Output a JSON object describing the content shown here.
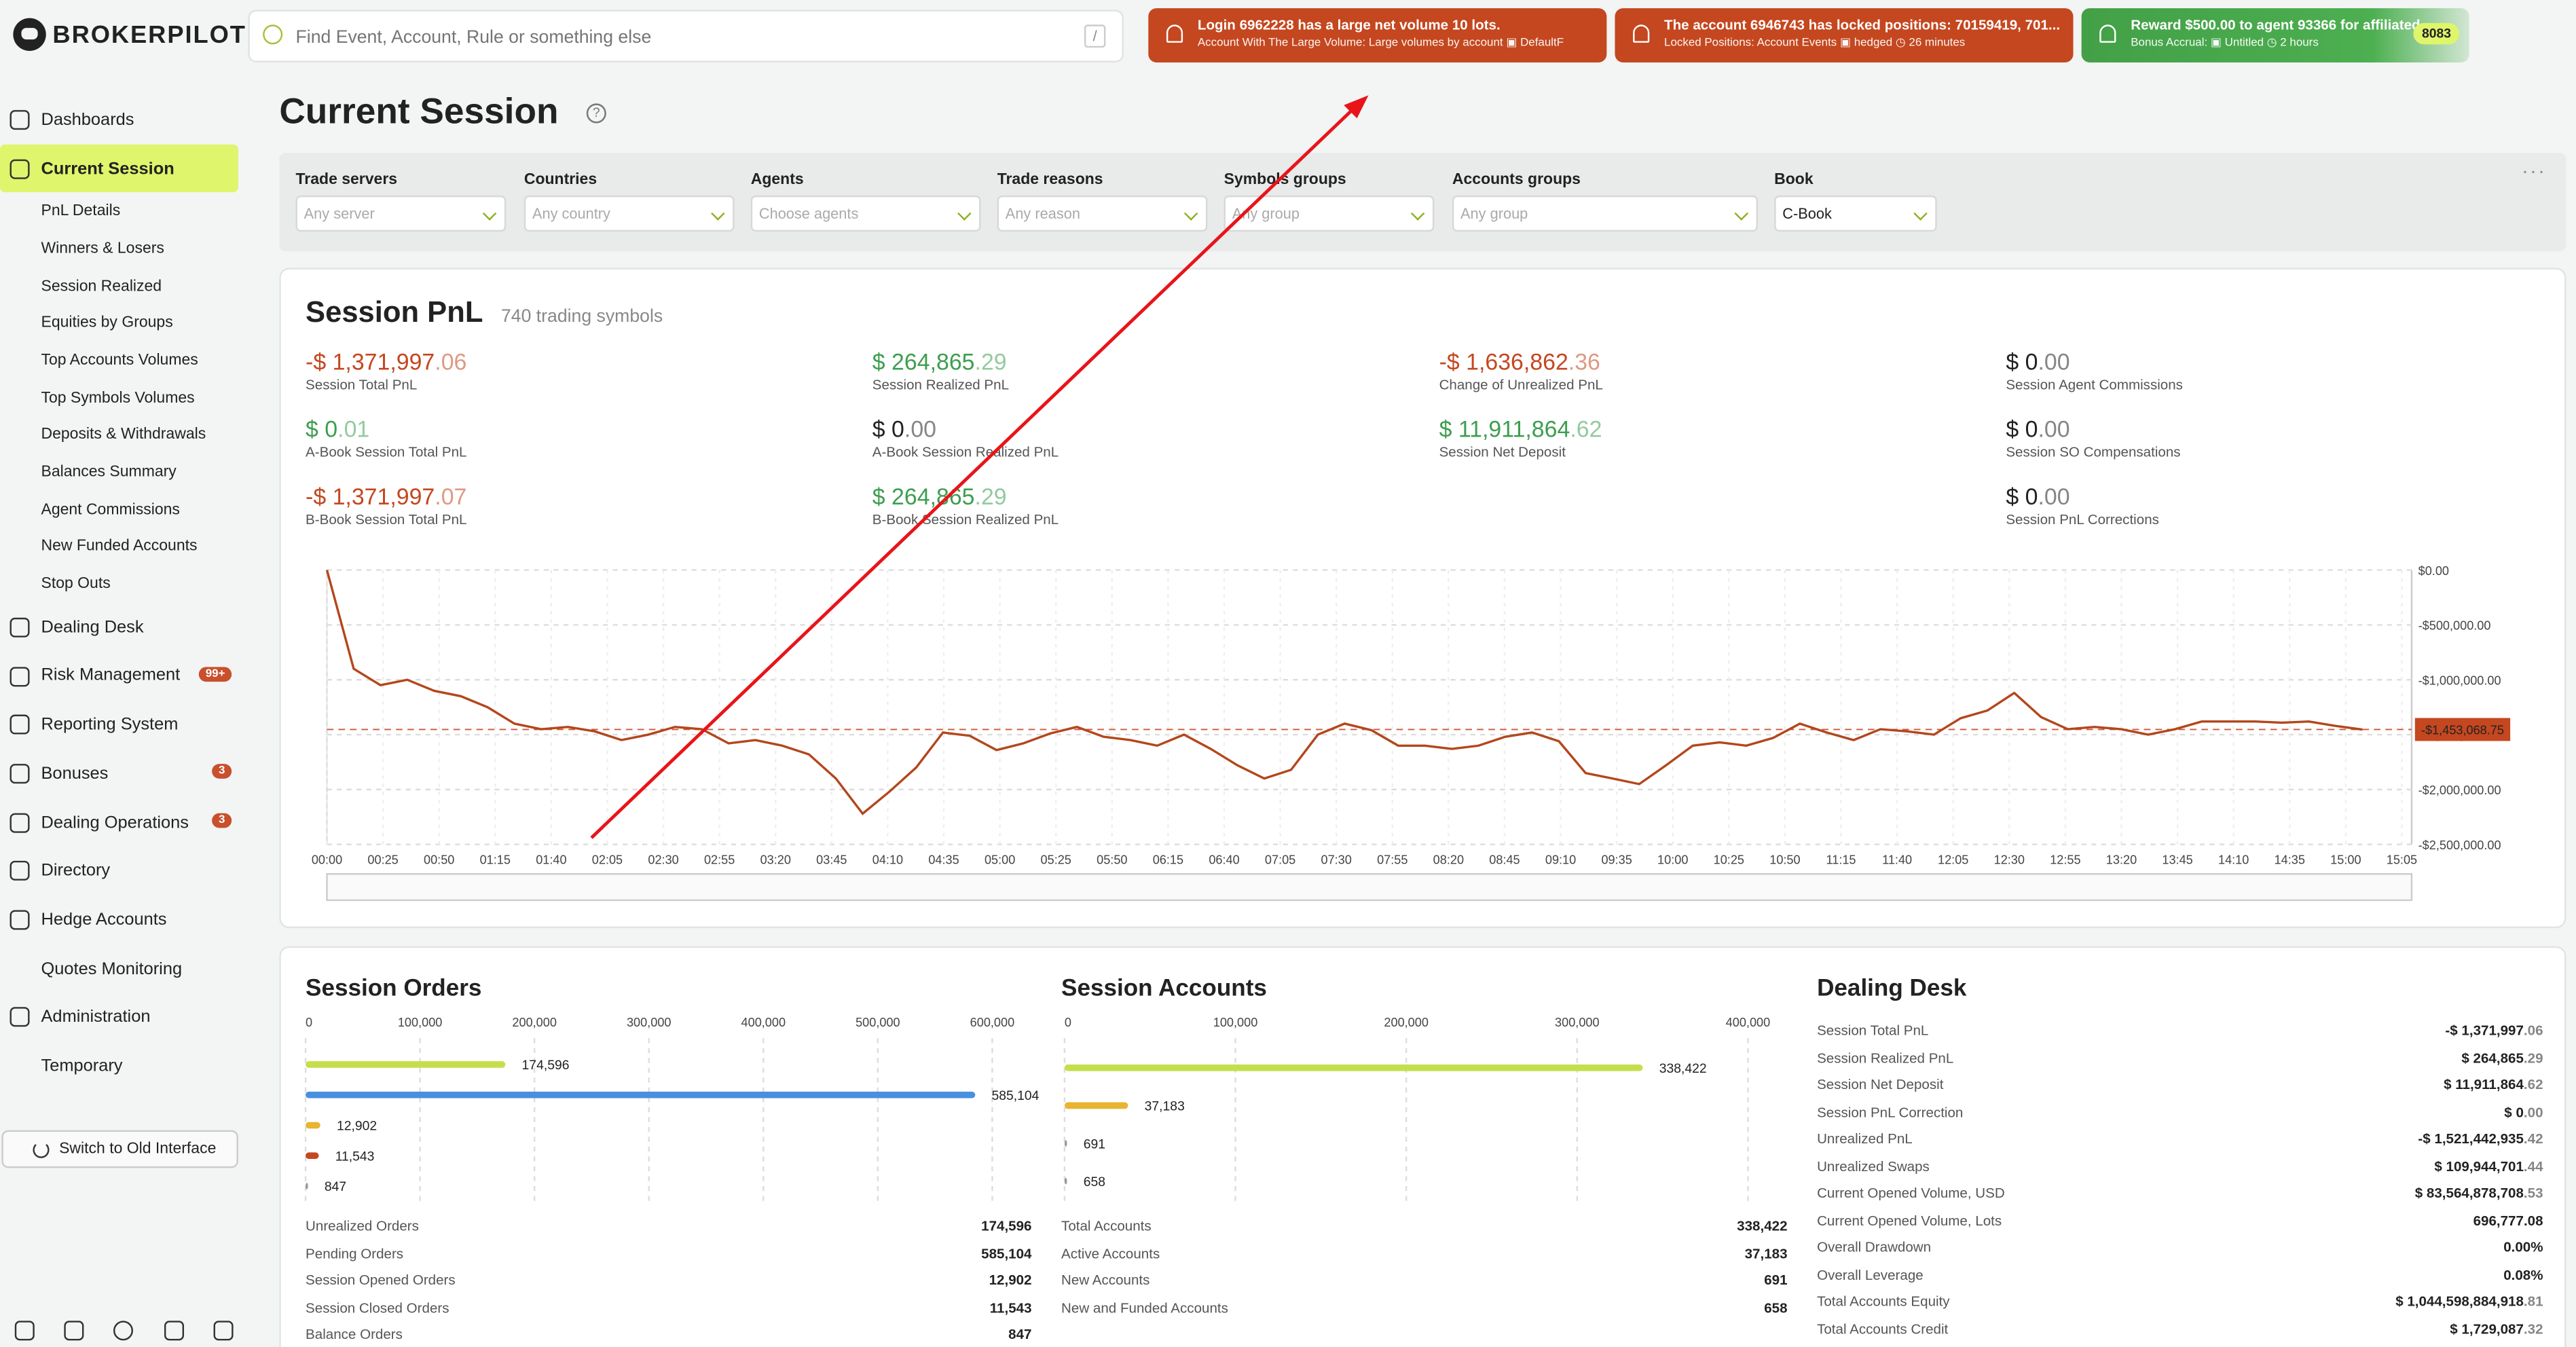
{
  "app": {
    "logo_text": "BROKERPILOT"
  },
  "search": {
    "placeholder": "Find Event, Account, Rule or something else",
    "shortcut": "/"
  },
  "notifications": [
    {
      "title": "Login 6962228 has a large net volume 10 lots.",
      "detail": "Account With The Large Volume: Large volumes by account",
      "tag": "DefaultF",
      "color": "#c4471f"
    },
    {
      "title": "The account 6946743 has locked positions: 70159419, 701...",
      "detail": "Locked Positions: Account Events",
      "tag": "hedged",
      "time": "26 minutes",
      "color": "#c4471f"
    },
    {
      "title": "Reward $500.00 to agent 93366 for affiliated",
      "detail": "Bonus Accrual:",
      "tag": "Untitled",
      "time": "2 hours",
      "count": "8083",
      "color": "#43a047"
    }
  ],
  "sidebar": {
    "items": [
      {
        "label": "Dashboards",
        "icon": "dashboard-icon"
      },
      {
        "label": "Current Session",
        "icon": "session-icon",
        "active": true
      },
      {
        "label": "Dealing Desk",
        "icon": "dealing-desk-icon"
      },
      {
        "label": "Risk Management",
        "icon": "risk-icon",
        "badge": "99+"
      },
      {
        "label": "Reporting System",
        "icon": "report-icon"
      },
      {
        "label": "Bonuses",
        "icon": "bonus-icon",
        "badge": "3"
      },
      {
        "label": "Dealing Operations",
        "icon": "operations-icon",
        "badge": "3"
      },
      {
        "label": "Directory",
        "icon": "directory-icon"
      },
      {
        "label": "Hedge Accounts",
        "icon": "hedge-icon"
      },
      {
        "label": "Quotes Monitoring"
      },
      {
        "label": "Administration",
        "icon": "admin-icon"
      },
      {
        "label": "Temporary"
      }
    ],
    "sub_items": [
      "PnL Details",
      "Winners & Losers",
      "Session Realized",
      "Equities by Groups",
      "Top Accounts Volumes",
      "Top Symbols Volumes",
      "Deposits & Withdrawals",
      "Balances Summary",
      "Agent Commissions",
      "New Funded Accounts",
      "Stop Outs"
    ],
    "switch_label": "Switch to Old Interface"
  },
  "page": {
    "title": "Current Session",
    "help": "?"
  },
  "filters": [
    {
      "label": "Trade servers",
      "placeholder": "Any server"
    },
    {
      "label": "Countries",
      "placeholder": "Any country"
    },
    {
      "label": "Agents",
      "placeholder": "Choose agents"
    },
    {
      "label": "Trade reasons",
      "placeholder": "Any reason"
    },
    {
      "label": "Symbols groups",
      "placeholder": "Any group"
    },
    {
      "label": "Accounts groups",
      "placeholder": "Any group"
    },
    {
      "label": "Book",
      "value": "C-Book"
    }
  ],
  "filters_more": "···",
  "session_pnl": {
    "title": "Session PnL",
    "subtitle": "740 trading symbols",
    "metrics": [
      {
        "main": "-$ 1,371,997",
        "cents": ".06",
        "label": "Session Total PnL",
        "tone": "neg"
      },
      {
        "main": "$ 0",
        "cents": ".01",
        "label": "A-Book Session Total PnL",
        "tone": "pos"
      },
      {
        "main": "-$ 1,371,997",
        "cents": ".07",
        "label": "B-Book Session Total PnL",
        "tone": "neg"
      },
      {
        "main": "$ 264,865",
        "cents": ".29",
        "label": "Session Realized PnL",
        "tone": "pos"
      },
      {
        "main": "$ 0",
        "cents": ".00",
        "label": "A-Book Session Realized PnL",
        "tone": "zero"
      },
      {
        "main": "$ 264,865",
        "cents": ".29",
        "label": "B-Book Session Realized PnL",
        "tone": "pos"
      },
      {
        "main": "-$ 1,636,862",
        "cents": ".36",
        "label": "Change of Unrealized PnL",
        "tone": "neg"
      },
      {
        "main": "$ 11,911,864",
        "cents": ".62",
        "label": "Session Net Deposit",
        "tone": "pos"
      },
      {
        "main": "$ 0",
        "cents": ".00",
        "label": "Session Agent Commissions",
        "tone": "zero"
      },
      {
        "main": "$ 0",
        "cents": ".00",
        "label": "Session SO Compensations",
        "tone": "zero"
      },
      {
        "main": "$ 0",
        "cents": ".00",
        "label": "Session PnL Corrections",
        "tone": "zero"
      }
    ]
  },
  "chart_data": {
    "type": "line",
    "x_ticks": [
      "00:00",
      "00:25",
      "00:50",
      "01:15",
      "01:40",
      "02:05",
      "02:30",
      "02:55",
      "03:20",
      "03:45",
      "04:10",
      "04:35",
      "05:00",
      "05:25",
      "05:50",
      "06:15",
      "06:40",
      "07:05",
      "07:30",
      "07:55",
      "08:20",
      "08:45",
      "09:10",
      "09:35",
      "10:00",
      "10:25",
      "10:50",
      "11:15",
      "11:40",
      "12:05",
      "12:30",
      "12:55",
      "13:20",
      "13:45",
      "14:10",
      "14:35",
      "15:00",
      "15:05"
    ],
    "y_ticks": [
      "$0.00",
      "-$500,000.00",
      "-$1,000,000.00",
      "-$1,500,000.00",
      "-$2,000,000.00",
      "-$2,500,000.00"
    ],
    "ylim": [
      -2500000,
      0
    ],
    "current_value_label": "-$1,453,068.75",
    "current_value": -1453068.75,
    "line_color": "#b3471c",
    "y_values": [
      0,
      -900000,
      -1050000,
      -1000000,
      -1100000,
      -1150000,
      -1250000,
      -1400000,
      -1450000,
      -1430000,
      -1470000,
      -1550000,
      -1500000,
      -1430000,
      -1450000,
      -1580000,
      -1550000,
      -1600000,
      -1680000,
      -1900000,
      -2220000,
      -2020000,
      -1800000,
      -1480000,
      -1510000,
      -1640000,
      -1580000,
      -1490000,
      -1430000,
      -1520000,
      -1550000,
      -1600000,
      -1500000,
      -1630000,
      -1780000,
      -1900000,
      -1820000,
      -1500000,
      -1400000,
      -1460000,
      -1600000,
      -1600000,
      -1630000,
      -1600000,
      -1520000,
      -1480000,
      -1560000,
      -1850000,
      -1900000,
      -1950000,
      -1780000,
      -1600000,
      -1570000,
      -1600000,
      -1530000,
      -1400000,
      -1480000,
      -1550000,
      -1450000,
      -1470000,
      -1500000,
      -1350000,
      -1280000,
      -1120000,
      -1340000,
      -1450000,
      -1430000,
      -1450000,
      -1500000,
      -1450000,
      -1380000,
      -1380000,
      -1380000,
      -1390000,
      -1380000,
      -1420000,
      -1453068
    ]
  },
  "session_orders": {
    "title": "Session Orders",
    "axis": [
      "0",
      "100,000",
      "200,000",
      "300,000",
      "400,000",
      "500,000",
      "600,000"
    ],
    "max": 600000,
    "bars": [
      {
        "value": 174596,
        "label": "174,596",
        "color": "#c5df4c"
      },
      {
        "value": 585104,
        "label": "585,104",
        "color": "#4a8fde"
      },
      {
        "value": 12902,
        "label": "12,902",
        "color": "#e8b431"
      },
      {
        "value": 11543,
        "label": "11,543",
        "color": "#c4471f"
      },
      {
        "value": 847,
        "label": "847",
        "color": "#999999"
      }
    ],
    "rows": [
      {
        "k": "Unrealized Orders",
        "v": "174,596"
      },
      {
        "k": "Pending Orders",
        "v": "585,104"
      },
      {
        "k": "Session Opened Orders",
        "v": "12,902"
      },
      {
        "k": "Session Closed Orders",
        "v": "11,543"
      },
      {
        "k": "Balance Orders",
        "v": "847"
      }
    ]
  },
  "session_accounts": {
    "title": "Session Accounts",
    "axis": [
      "0",
      "100,000",
      "200,000",
      "300,000",
      "400,000"
    ],
    "max": 400000,
    "bars": [
      {
        "value": 338422,
        "label": "338,422",
        "color": "#c5df4c"
      },
      {
        "value": 37183,
        "label": "37,183",
        "color": "#e8b431"
      },
      {
        "value": 691,
        "label": "691",
        "color": "#999999"
      },
      {
        "value": 658,
        "label": "658",
        "color": "#999999"
      }
    ],
    "rows": [
      {
        "k": "Total Accounts",
        "v": "338,422"
      },
      {
        "k": "Active Accounts",
        "v": "37,183"
      },
      {
        "k": "New Accounts",
        "v": "691"
      },
      {
        "k": "New and Funded Accounts",
        "v": "658"
      }
    ]
  },
  "dealing_desk": {
    "title": "Dealing Desk",
    "rows": [
      {
        "k": "Session Total PnL",
        "main": "-$ 1,371,997",
        "cents": ".06",
        "tone": "neg"
      },
      {
        "k": "Session Realized PnL",
        "main": "$ 264,865",
        "cents": ".29",
        "tone": "pos"
      },
      {
        "k": "Session Net Deposit",
        "main": "$ 11,911,864",
        "cents": ".62",
        "tone": "pos"
      },
      {
        "k": "Session PnL Correction",
        "main": "$ 0",
        "cents": ".00",
        "tone": "pos"
      },
      {
        "k": "Unrealized PnL",
        "main": "-$ 1,521,442,935",
        "cents": ".42",
        "tone": "neg"
      },
      {
        "k": "Unrealized Swaps",
        "main": "$ 109,944,701",
        "cents": ".44",
        "tone": "pos"
      },
      {
        "k": "Current Opened Volume, USD",
        "main": "$ 83,564,878,708",
        "cents": ".53",
        "tone": "pos"
      },
      {
        "k": "Current Opened Volume, Lots",
        "main": "696,777.08",
        "cents": "",
        "tone": "zero"
      },
      {
        "k": "Overall Drawdown",
        "main": "0.00%",
        "cents": "",
        "tone": "zero"
      },
      {
        "k": "Overall Leverage",
        "main": "0.08%",
        "cents": "",
        "tone": "zero"
      },
      {
        "k": "Total Accounts Equity",
        "main": "$ 1,044,598,884,918",
        "cents": ".81",
        "tone": "pos"
      },
      {
        "k": "Total Accounts Credit",
        "main": "$ 1,729,087",
        "cents": ".32",
        "tone": "pos"
      }
    ]
  }
}
